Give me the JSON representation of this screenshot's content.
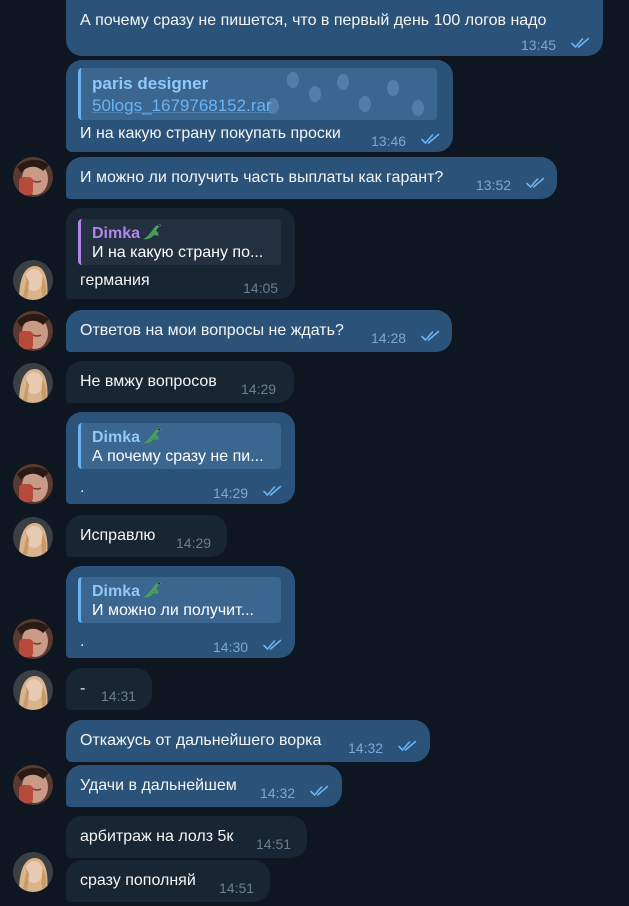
{
  "messages": [
    {
      "text": "А почему сразу не пишется, что в первый день 100 логов надо",
      "time": "13:45"
    },
    {
      "file_sender": "paris designer",
      "file_name": "50logs_1679768152.rar",
      "text": "И на какую страну покупать проски",
      "time": "13:46"
    },
    {
      "text": "И можно ли получить часть выплаты как гарант?",
      "time": "13:52"
    },
    {
      "reply_name": "Dimka",
      "reply_text": "И на какую страну по...",
      "text": "германия",
      "time": "14:05"
    },
    {
      "text": "Ответов на мои вопросы не ждать?",
      "time": "14:28"
    },
    {
      "text": "Не вмжу вопросов",
      "time": "14:29"
    },
    {
      "reply_name": "Dimka",
      "reply_text": "А почему сразу не пи...",
      "text": ".",
      "time": "14:29"
    },
    {
      "text": "Исправлю",
      "time": "14:29"
    },
    {
      "reply_name": "Dimka",
      "reply_text": "И можно ли получит...",
      "text": ".",
      "time": "14:30"
    },
    {
      "text": "-",
      "time": "14:31"
    },
    {
      "text": "Откажусь от дальнейшего ворка",
      "time": "14:32"
    },
    {
      "text": "Удачи в дальнейшем",
      "time": "14:32"
    },
    {
      "text": "арбитраж на лолз 5к",
      "time": "14:51"
    },
    {
      "text": "сразу пополняй",
      "time": "14:51"
    }
  ],
  "icons": {
    "read_receipt": "double-check-icon",
    "reply_emoji": "crocodile-emoji-icon",
    "avatar_a": "user-avatar-a",
    "avatar_b": "user-avatar-b"
  },
  "colors": {
    "background": "#0e1621",
    "outgoing_bubble": "#2b5278",
    "incoming_bubble": "#182533",
    "link": "#6ab3f3",
    "reply_name_incoming": "#b286e8"
  }
}
